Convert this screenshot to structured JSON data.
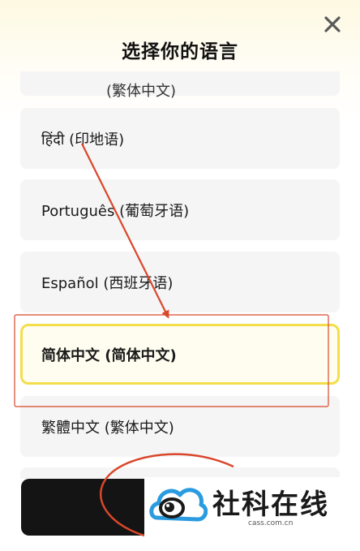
{
  "dialog": {
    "title": "选择你的语言",
    "close_icon": "close-icon"
  },
  "languages": [
    {
      "label": "(繁体中文)",
      "selected": false,
      "partial": true
    },
    {
      "label": "हिंदी (印地语)",
      "selected": false
    },
    {
      "label": "Português (葡萄牙语)",
      "selected": false
    },
    {
      "label": "Español (西班牙语)",
      "selected": false
    },
    {
      "label": "简体中文 (简体中文)",
      "selected": true
    },
    {
      "label": "繁體中文 (繁体中文)",
      "selected": false
    },
    {
      "label": "",
      "selected": false,
      "partial": true
    }
  ],
  "colors": {
    "selected_border": "#f3de4a",
    "annotation_red": "#d9472b",
    "button": "#141414"
  },
  "watermark": {
    "text": "社科在线",
    "url": "cass.com.cn",
    "logo_icon": "cloud-eye-logo-icon"
  }
}
